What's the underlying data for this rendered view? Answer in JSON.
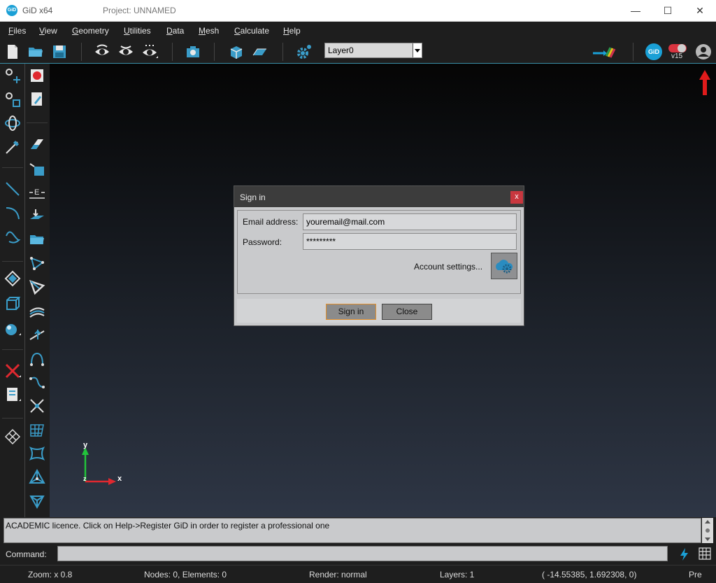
{
  "window": {
    "app_title": "GiD x64",
    "logo_text": "GiD",
    "project_title": "Project: UNNAMED",
    "minimize_glyph": "—",
    "maximize_glyph": "☐",
    "close_glyph": "✕"
  },
  "menu": {
    "items": [
      {
        "accel": "F",
        "rest": "iles"
      },
      {
        "accel": "V",
        "rest": "iew"
      },
      {
        "accel": "G",
        "rest": "eometry"
      },
      {
        "accel": "U",
        "rest": "tilities"
      },
      {
        "accel": "D",
        "rest": "ata"
      },
      {
        "accel": "M",
        "rest": "esh"
      },
      {
        "accel": "C",
        "rest": "alculate"
      },
      {
        "accel": "H",
        "rest": "elp"
      }
    ]
  },
  "toolbar": {
    "layer_value": "Layer0",
    "version_label": "v15",
    "gid_badge": "GiD"
  },
  "dialog": {
    "title": "Sign in",
    "close_glyph": "x",
    "email_label": "Email address:",
    "email_value": "youremail@mail.com",
    "password_label": "Password:",
    "password_value": "*********",
    "account_settings_label": "Account settings...",
    "signin_button": "Sign in",
    "close_button": "Close"
  },
  "messages": {
    "text": "ACADEMIC licence. Click on Help->Register GiD in order to register a professional one"
  },
  "command": {
    "label": "Command:",
    "value": ""
  },
  "axes": {
    "y": "y",
    "x": "x",
    "z": "z"
  },
  "status": {
    "zoom": "Zoom: x 0.8",
    "nodes": "Nodes: 0, Elements: 0",
    "render": "Render: normal",
    "layers": "Layers: 1",
    "coords": "( -14.55385,  1.692308,  0)",
    "mode": "Pre"
  },
  "colors": {
    "accent": "#1aa0d6",
    "close_red": "#c8373f",
    "focus_orange": "#e3902d",
    "arrow_red": "#e01b1b"
  }
}
